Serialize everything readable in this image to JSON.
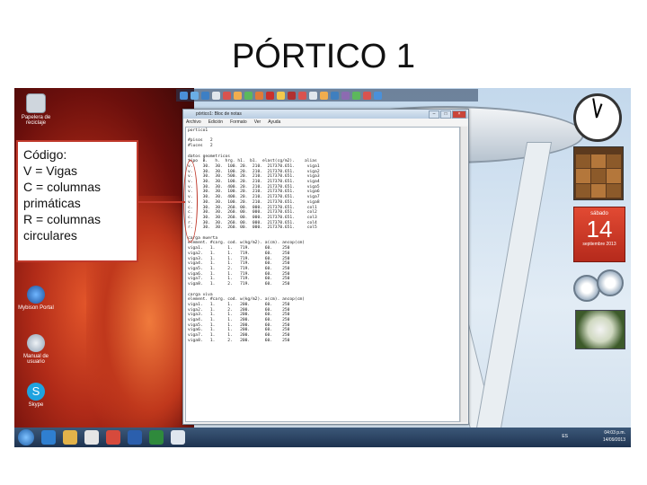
{
  "slide": {
    "title": "PÓRTICO 1"
  },
  "legend": {
    "lines": [
      "Código:",
      "V = Vigas",
      "C = columnas",
      "primáticas",
      "R = columnas",
      "circulares"
    ]
  },
  "notepad": {
    "title": "pórtico1: Bloc de notas",
    "menu": [
      "Archivo",
      "Edición",
      "Formato",
      "Ver",
      "Ayuda"
    ],
    "content": "portico1\n\n#pisos   2\n#luces   2\n\ndatos geometricos\ntipo  B.   h.  hrg. h1.  b1.  elast(cg/m2).    alias\nv.    30.  30.  100. 20.  210.  217370.651.     viga1\nv.    30.  30.  100. 20.  210.  217370.651.     viga2\nv.    30.  30.  500. 20.  210.  217370.651.     viga3\nv.    30.  30.  100. 20.  210.  217370.651.     viga4\nv.    30.  30.  400. 20.  210.  217370.651.     viga5\nv.    30.  30.  100. 20.  210.  217370.651.     viga6\nv.    30.  30.  400. 20.  210.  217370.651.     viga7\nv.    30.  30.  100. 20.  210.  217370.651.     viga8\nc.    30.  30.  260. 00.  000.  217370.651.     col1\nc.    30.  30.  260. 00.  000.  217370.651.     col2\nc.    30.  30.  260. 00.  000.  217370.651.     col3\nr.    30.  30.  260. 00.  000.  217370.651.     col4\nr.    30.  30.  260. 00.  000.  217370.651.     col5\n\ncarga muerta\nelement. #carg. cod. w(kg/m2). a(cm). ancop(cm)\nviga1.   1.     1.   719.      60.    250\nviga2.   1.     1.   719.      60.    250\nviga3.   1.     1.   719.      60.    250\nviga4.   1.     1.   719.      60.    250\nviga5.   1.     2.   719.      60.    250\nviga6.   1.     1.   719.      60.    250\nviga7.   1.     1.   719.      60.    250\nviga8.   1.     2.   719.      60.    250\n\ncarga viva\nelement. #carg. cod. w(kg/m2). a(cm). ancop(cm)\nviga1.   1.     1.   200.      60.    250\nviga2.   1.     2.   200.      60.    250\nviga3.   1.     1.   200.      60.    250\nviga4.   1.     1.   200.      60.    250\nviga5.   1.     1.   200.      60.    250\nviga6.   1.     1.   200.      60.    250\nviga7.   1.     1.   200.      60.    250\nviga8.   1.     2.   200.      60.    250"
  },
  "desktop_icons": [
    {
      "label": "Papelera de reciclaje",
      "icon": "recycle-bin-icon"
    },
    {
      "label": "Mybison Portal",
      "icon": "portal-icon"
    },
    {
      "label": "Manual de usuario",
      "icon": "manual-icon"
    },
    {
      "label": "Skype",
      "icon": "skype-icon"
    }
  ],
  "calendar": {
    "weekday": "sábado",
    "day": "14",
    "month_year": "septiembre 2013"
  },
  "tray": {
    "language": "ES",
    "time": "04:03 p.m.",
    "date": "14/09/2013"
  },
  "colors": {
    "annotation": "#c0392b",
    "taskbar": "#1e3350",
    "calendar": "#e24a33"
  }
}
